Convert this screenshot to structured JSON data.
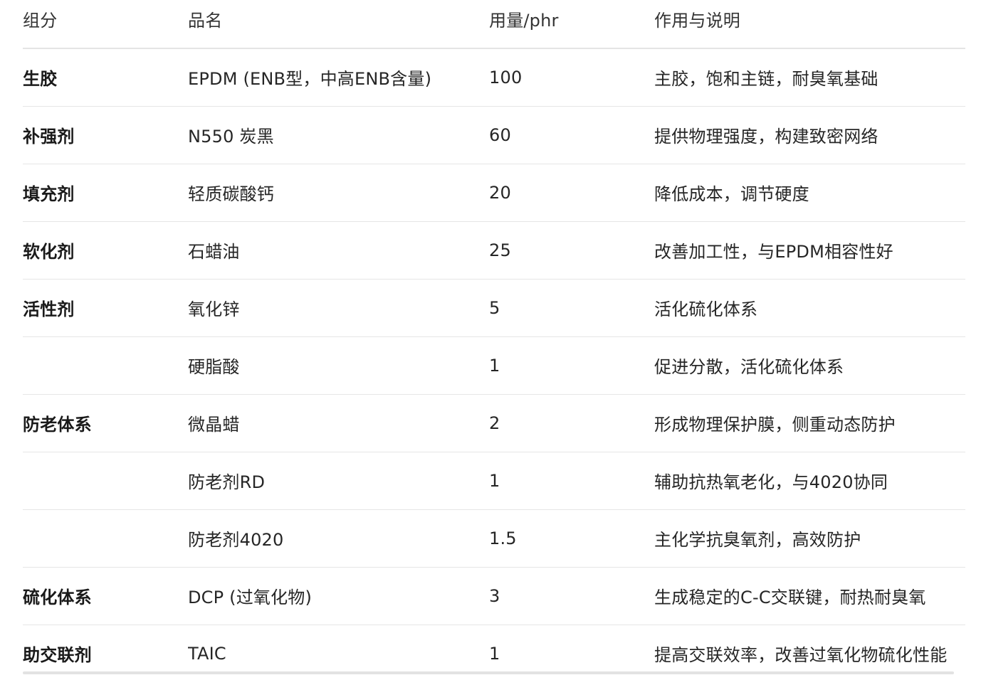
{
  "table": {
    "headers": [
      "组分",
      "品名",
      "用量/phr",
      "作用与说明"
    ],
    "rows": [
      {
        "component": "生胶",
        "name": "EPDM (ENB型，中高ENB含量)",
        "amount": "100",
        "note": "主胶，饱和主链，耐臭氧基础"
      },
      {
        "component": "补强剂",
        "name": "N550 炭黑",
        "amount": "60",
        "note": "提供物理强度，构建致密网络"
      },
      {
        "component": "填充剂",
        "name": "轻质碳酸钙",
        "amount": "20",
        "note": "降低成本，调节硬度"
      },
      {
        "component": "软化剂",
        "name": "石蜡油",
        "amount": "25",
        "note": "改善加工性，与EPDM相容性好"
      },
      {
        "component": "活性剂",
        "name": "氧化锌",
        "amount": "5",
        "note": "活化硫化体系"
      },
      {
        "component": "",
        "name": "硬脂酸",
        "amount": "1",
        "note": "促进分散，活化硫化体系"
      },
      {
        "component": "防老体系",
        "name": "微晶蜡",
        "amount": "2",
        "note": "形成物理保护膜，侧重动态防护"
      },
      {
        "component": "",
        "name": "防老剂RD",
        "amount": "1",
        "note": "辅助抗热氧老化，与4020协同"
      },
      {
        "component": "",
        "name": "防老剂4020",
        "amount": "1.5",
        "note": "主化学抗臭氧剂，高效防护"
      },
      {
        "component": "硫化体系",
        "name": "DCP (过氧化物)",
        "amount": "3",
        "note": "生成稳定的C-C交联键，耐热耐臭氧"
      },
      {
        "component": "助交联剂",
        "name": "TAIC",
        "amount": "1",
        "note": "提高交联效率，改善过氧化物硫化性能"
      }
    ]
  }
}
